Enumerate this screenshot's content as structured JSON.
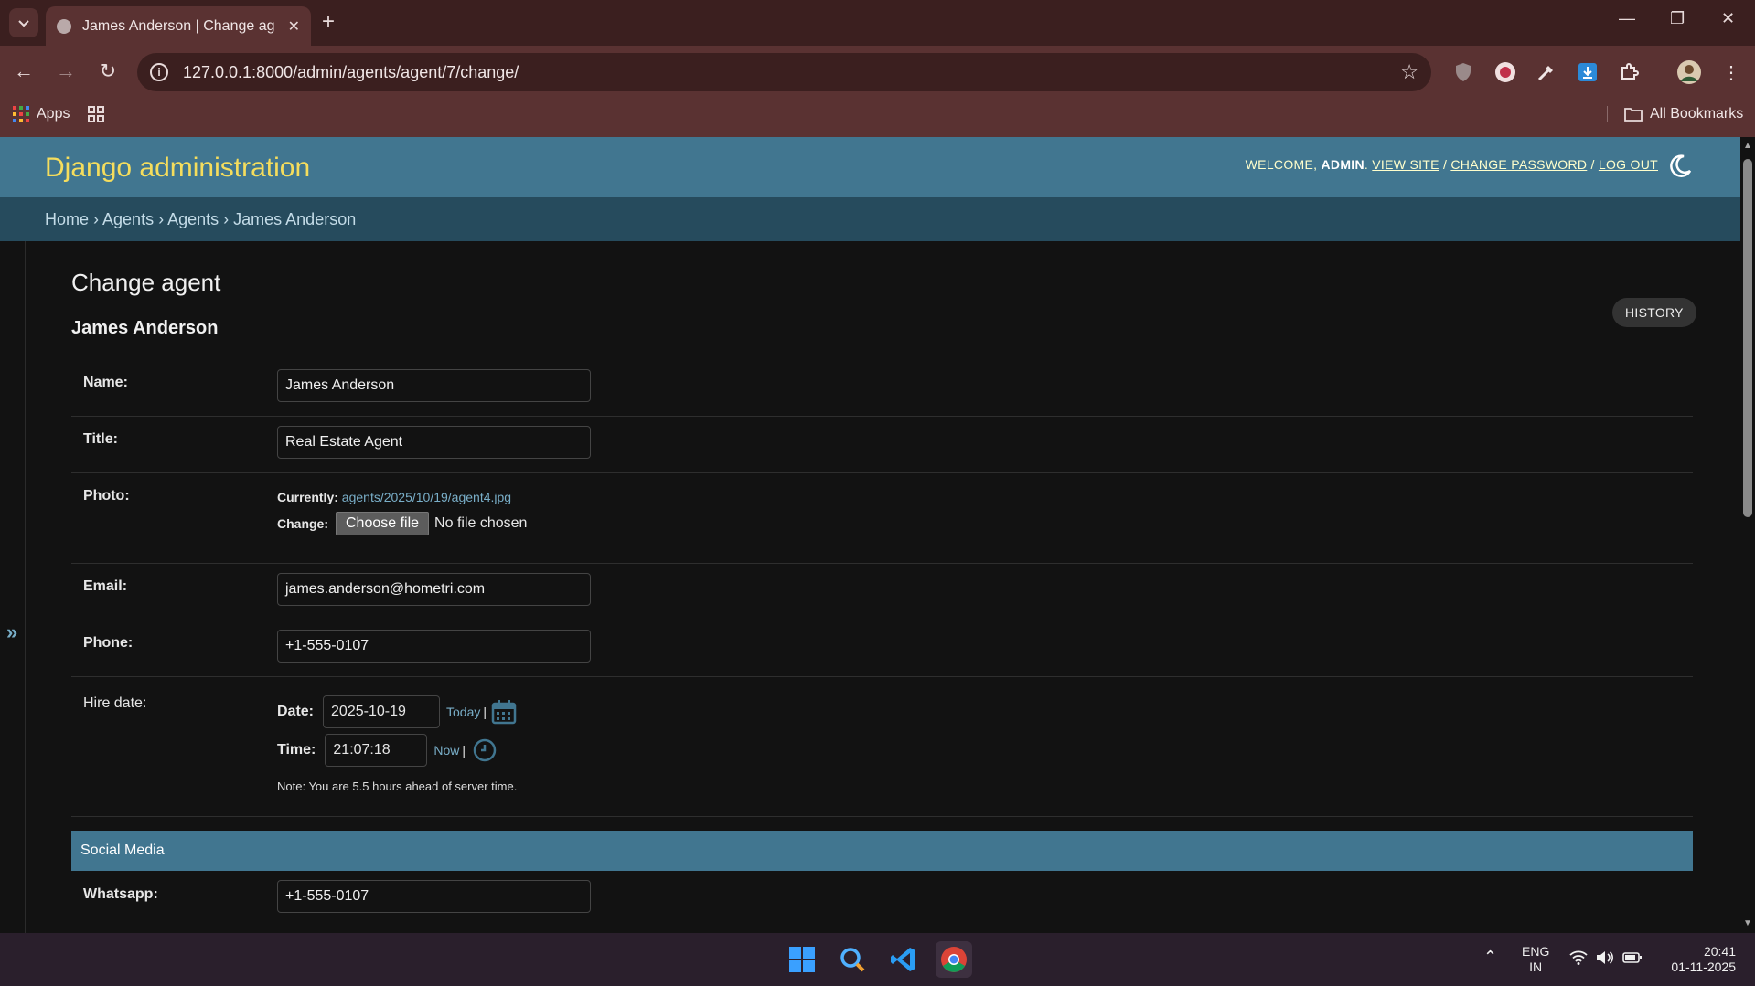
{
  "browser": {
    "tab_title": "James Anderson | Change agent | Django site admin",
    "url": "127.0.0.1:8000/admin/agents/agent/7/change/",
    "bookmarks": {
      "apps_label": "Apps",
      "all_bookmarks_label": "All Bookmarks"
    }
  },
  "header": {
    "brand": "Django administration",
    "welcome": "WELCOME,",
    "user": "ADMIN",
    "view_site": "VIEW SITE",
    "change_password": "CHANGE PASSWORD",
    "logout": "LOG OUT"
  },
  "breadcrumbs": [
    "Home",
    "Agents",
    "Agents",
    "James Anderson"
  ],
  "content": {
    "title": "Change agent",
    "object_name": "James Anderson",
    "history_label": "HISTORY"
  },
  "form": {
    "name": {
      "label": "Name:",
      "value": "James Anderson"
    },
    "title": {
      "label": "Title:",
      "value": "Real Estate Agent"
    },
    "photo": {
      "label": "Photo:",
      "currently_label": "Currently:",
      "currently_value": "agents/2025/10/19/agent4.jpg",
      "change_label": "Change:",
      "choose_button": "Choose file",
      "no_file": "No file chosen"
    },
    "email": {
      "label": "Email:",
      "value": "james.anderson@hometri.com"
    },
    "phone": {
      "label": "Phone:",
      "value": "+1-555-0107"
    },
    "hire_date": {
      "label": "Hire date:",
      "date_label": "Date:",
      "date_value": "2025-10-19",
      "today_link": "Today",
      "time_label": "Time:",
      "time_value": "21:07:18",
      "now_link": "Now",
      "sep": "|",
      "note": "Note: You are 5.5 hours ahead of server time."
    },
    "social_media_title": "Social Media",
    "whatsapp": {
      "label": "Whatsapp:",
      "value": "+1-555-0107"
    }
  },
  "taskbar": {
    "lang_top": "ENG",
    "lang_bottom": "IN",
    "time": "20:41",
    "date": "01-11-2025"
  },
  "colors": {
    "header_bg": "#417690",
    "brand": "#f5dd5d",
    "breadcrumbs_bg": "#264b5d",
    "link": "#79aec8"
  }
}
